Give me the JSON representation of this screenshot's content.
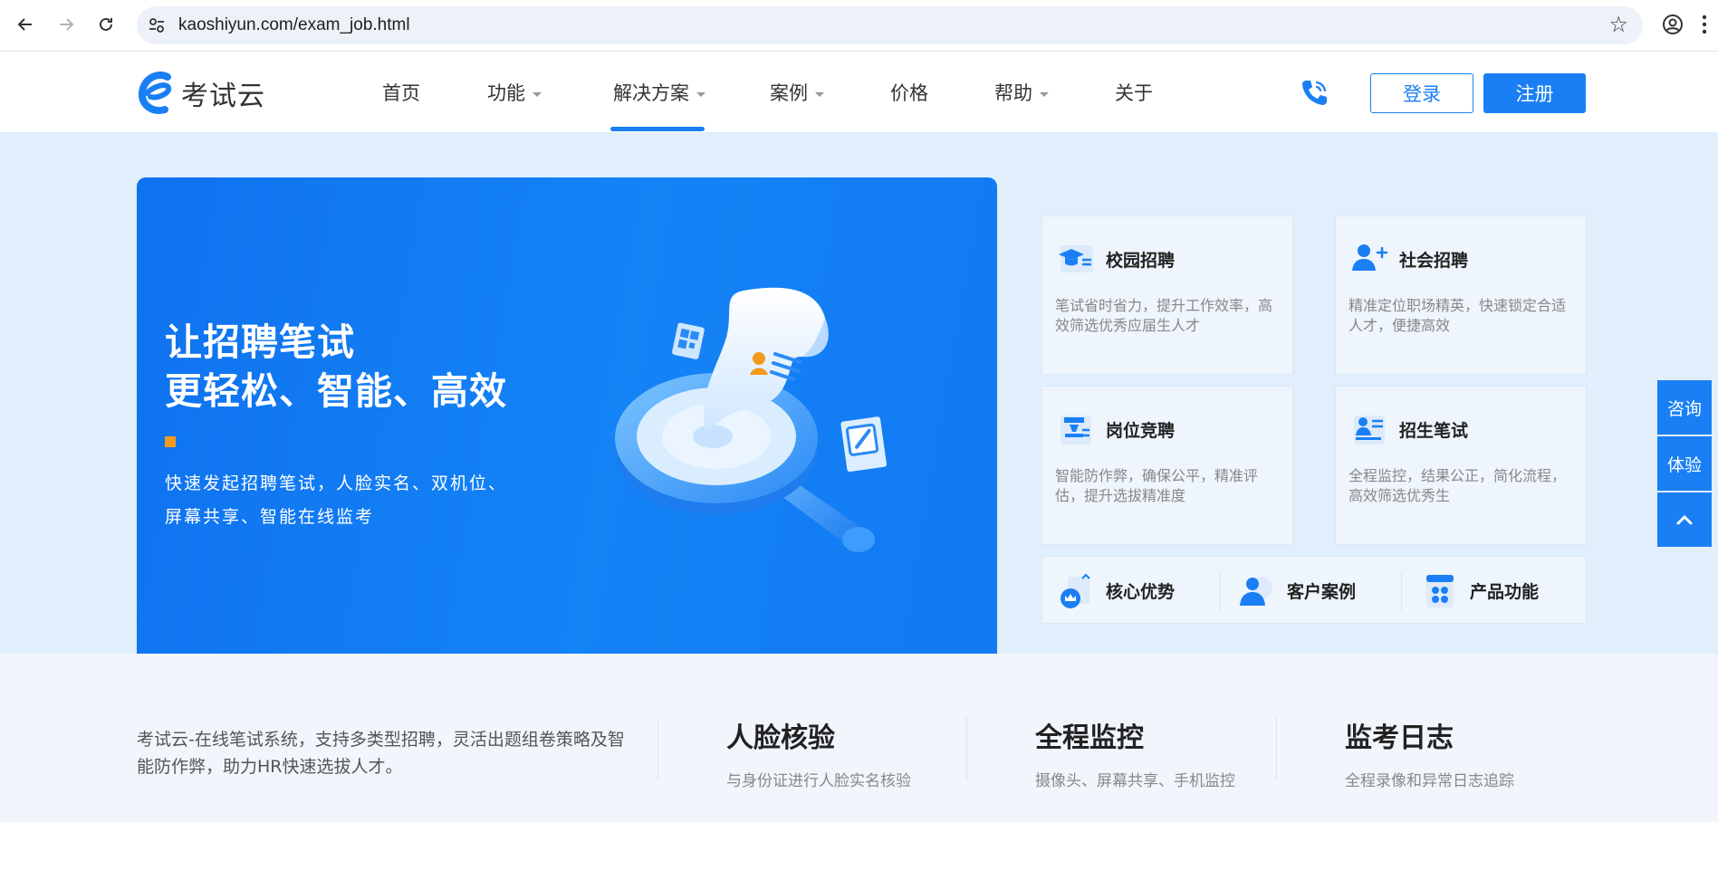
{
  "browser": {
    "url": "kaoshiyun.com/exam_job.html"
  },
  "header": {
    "logo_text": "考试云",
    "menu": [
      {
        "label": "首页",
        "has_caret": false
      },
      {
        "label": "功能",
        "has_caret": true
      },
      {
        "label": "解决方案",
        "has_caret": true,
        "active": true
      },
      {
        "label": "案例",
        "has_caret": true
      },
      {
        "label": "价格",
        "has_caret": false
      },
      {
        "label": "帮助",
        "has_caret": true
      },
      {
        "label": "关于",
        "has_caret": false
      }
    ],
    "login_label": "登录",
    "register_label": "注册"
  },
  "hero": {
    "title_line1": "让招聘笔试",
    "title_line2": "更轻松、智能、高效",
    "desc": "快速发起招聘笔试，人脸实名、双机位、屏幕共享、智能在线监考"
  },
  "solutions": [
    {
      "title": "校园招聘",
      "desc": "笔试省时省力，提升工作效率，高效筛选优秀应届生人才",
      "icon": "graduation-cap-icon"
    },
    {
      "title": "社会招聘",
      "desc": "精准定位职场精英，快速锁定合适人才，便捷高效",
      "icon": "person-plus-icon"
    },
    {
      "title": "岗位竞聘",
      "desc": "智能防作弊，确保公平，精准评估，提升选拔精准度",
      "icon": "podium-icon"
    },
    {
      "title": "招生笔试",
      "desc": "全程监控，结果公正，简化流程，高效筛选优秀生",
      "icon": "student-exam-icon"
    }
  ],
  "quick_links": [
    {
      "label": "核心优势",
      "icon": "crown-badge-icon"
    },
    {
      "label": "客户案例",
      "icon": "customer-icon"
    },
    {
      "label": "产品功能",
      "icon": "product-grid-icon"
    }
  ],
  "float_buttons": {
    "consult": "咨询",
    "trial": "体验"
  },
  "stats": {
    "intro": "考试云-在线笔试系统，支持多类型招聘，灵活出题组卷策略及智能防作弊，助力HR快速选拔人才。",
    "items": [
      {
        "title": "人脸核验",
        "sub": "与身份证进行人脸实名核验"
      },
      {
        "title": "全程监控",
        "sub": "摄像头、屏幕共享、手机监控"
      },
      {
        "title": "监考日志",
        "sub": "全程录像和异常日志追踪"
      }
    ]
  },
  "colors": {
    "brand_blue": "#1a7ff5",
    "hero_bg": "#e1eefb",
    "accent_orange": "#f39a1e"
  }
}
